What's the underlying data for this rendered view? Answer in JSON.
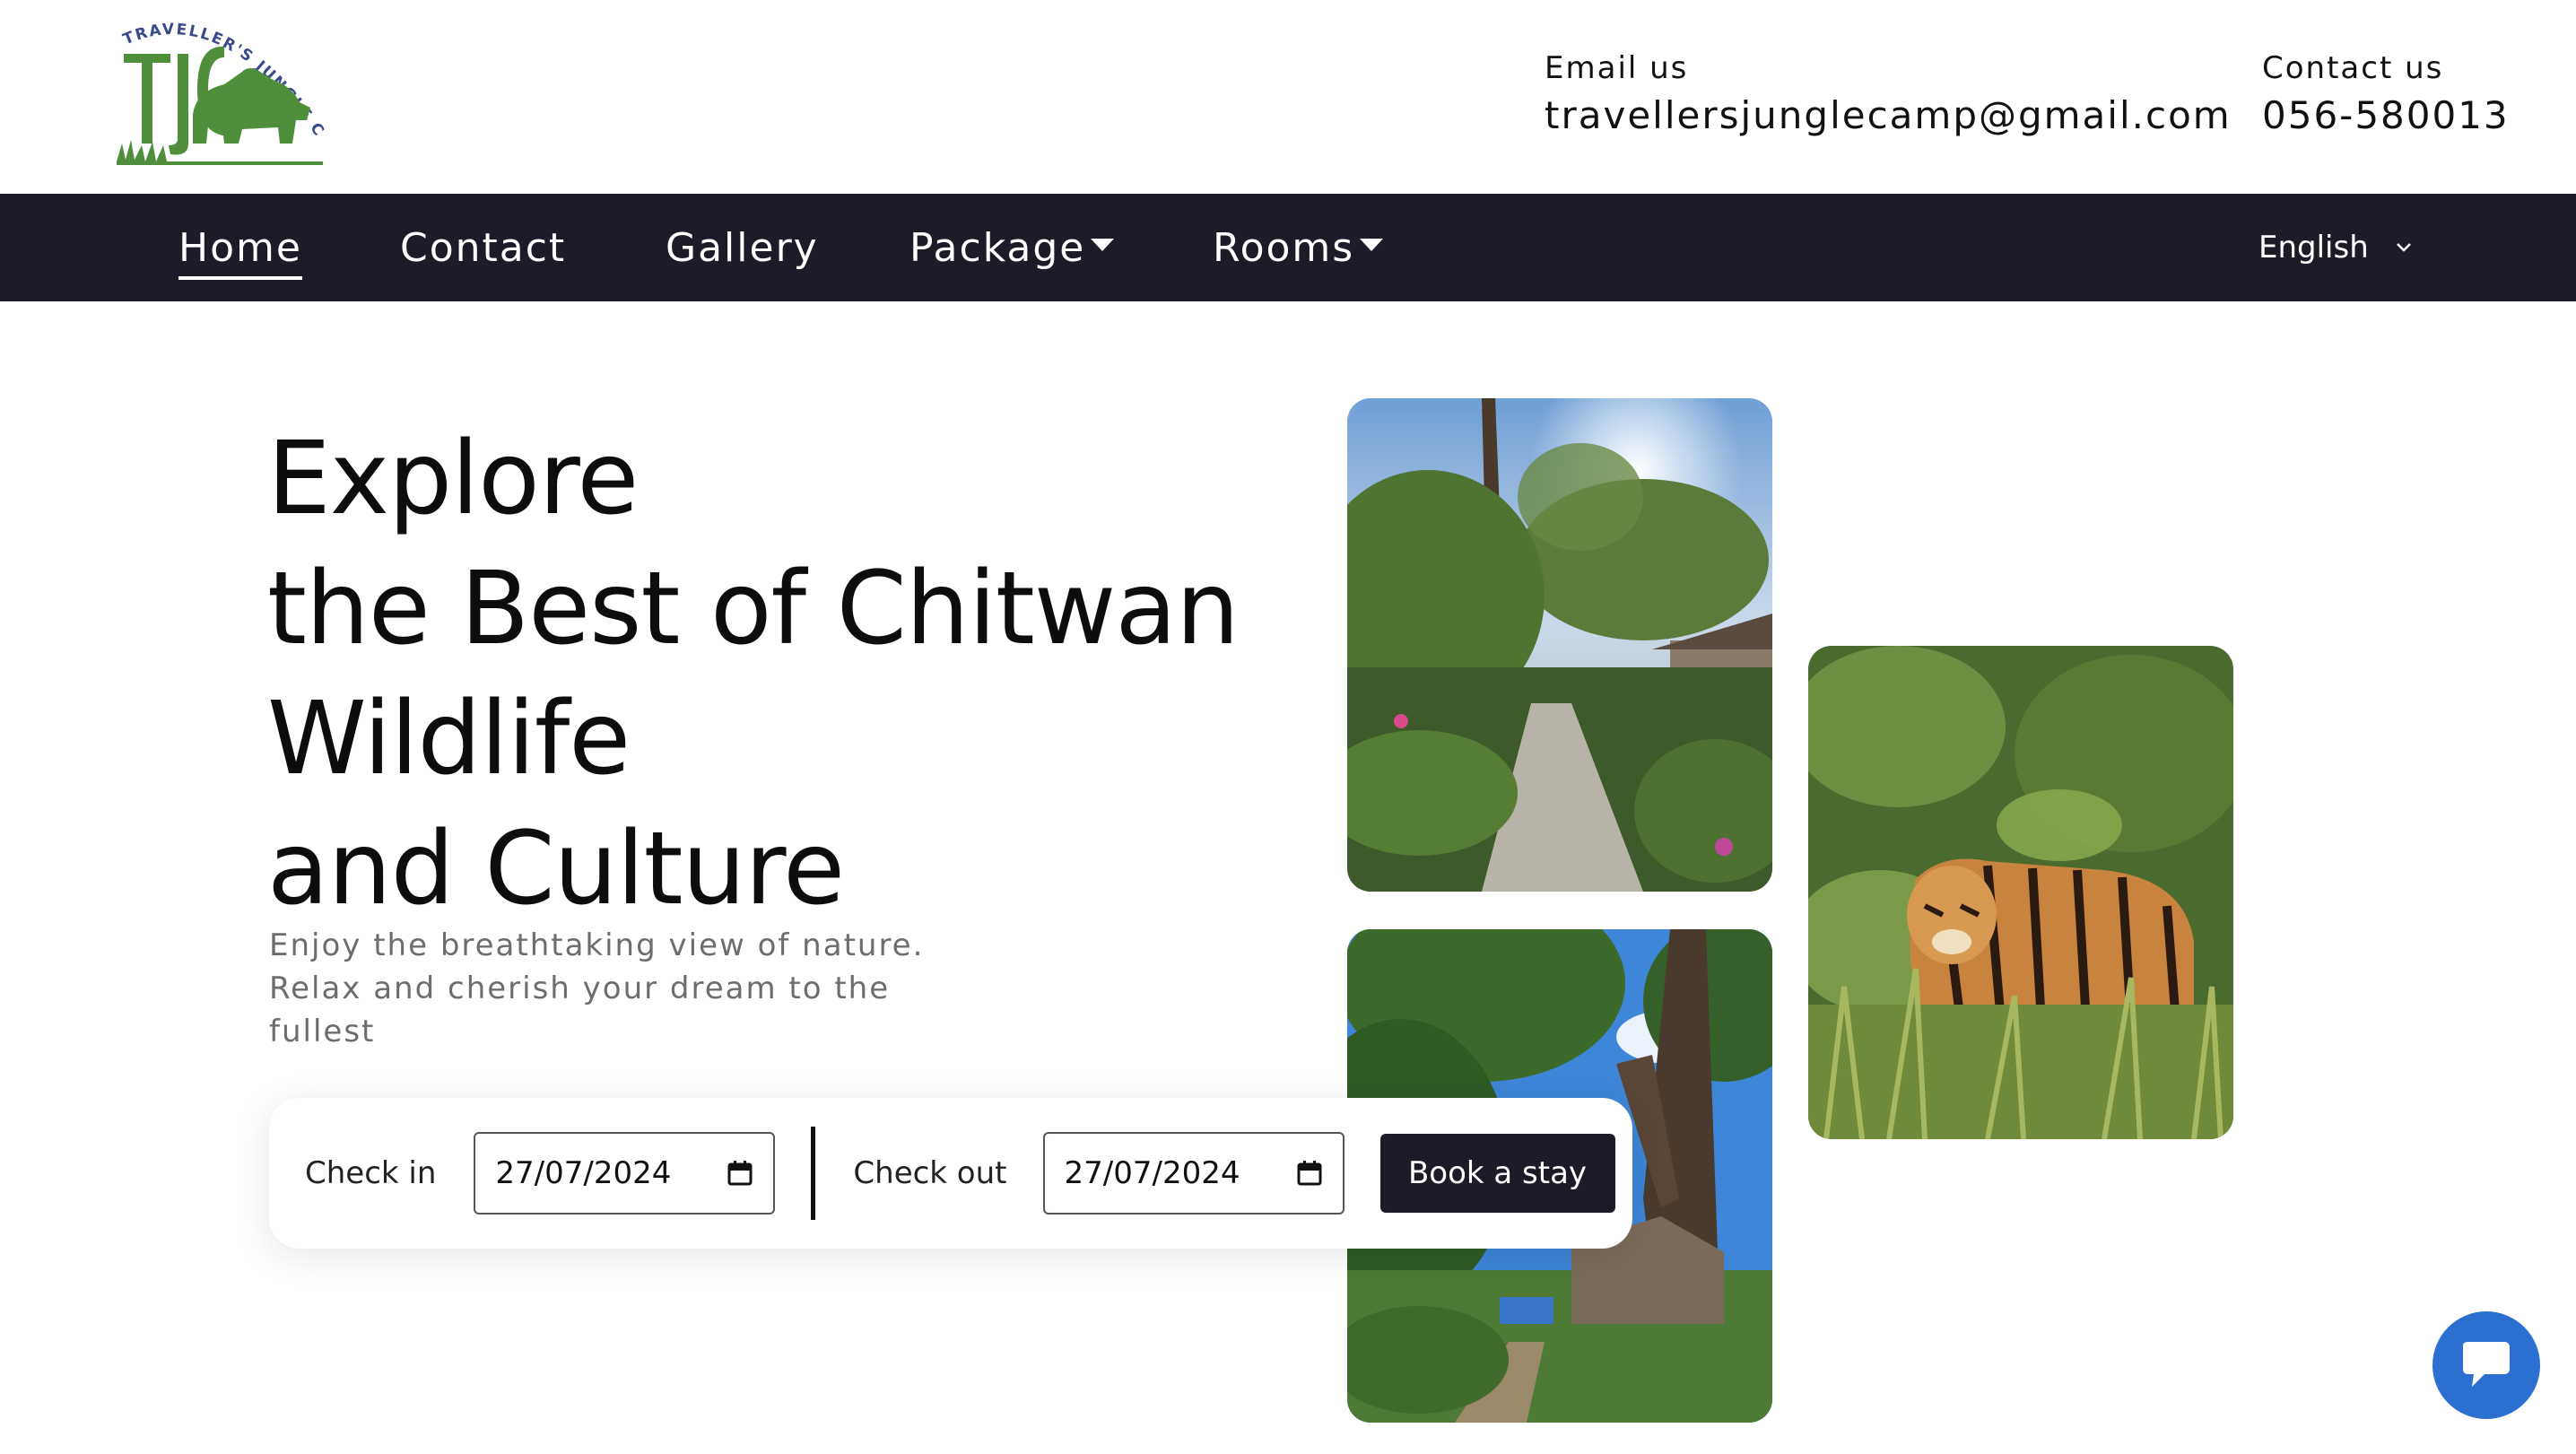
{
  "brand": {
    "logo_text": "TRAVELLER'S JUNGLE CAMP",
    "logo_letters": "TJC",
    "colors": {
      "green": "#4f8f3c",
      "navy": "#3a4a8a",
      "nav_bg": "#1c1b27",
      "chat_blue": "#2b6fd1"
    }
  },
  "header": {
    "email_label": "Email us",
    "email_value": "travellersjunglecamp@gmail.com",
    "phone_label": "Contact us",
    "phone_value": "056-580013"
  },
  "nav": {
    "home": "Home",
    "contact": "Contact",
    "gallery": "Gallery",
    "package": "Package",
    "rooms": "Rooms",
    "language": "English"
  },
  "hero": {
    "line1": "Explore",
    "line2": "the Best of Chitwan",
    "line3": "Wildlife",
    "line4": "and Culture",
    "subtitle": "Enjoy the breathtaking view of nature. Relax and cherish your dream to the fullest"
  },
  "booking": {
    "checkin_label": "Check in",
    "checkin_value": "27/07/2024",
    "checkout_label": "Check out",
    "checkout_value": "27/07/2024",
    "button_label": "Book a stay"
  },
  "icons": {
    "dropdown": "caret-down-icon",
    "language": "chevron-down-icon",
    "date": "calendar-icon",
    "chat": "chat-bubble-icon"
  }
}
